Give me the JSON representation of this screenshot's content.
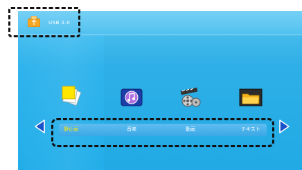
{
  "header": {
    "device_label": "USB 2.0",
    "device_icon": "usb-drive-icon"
  },
  "categories": [
    {
      "label": "静止画",
      "icon": "photo-icon",
      "selected": true
    },
    {
      "label": "音楽",
      "icon": "music-icon",
      "selected": false
    },
    {
      "label": "動画",
      "icon": "film-reel-icon",
      "selected": false
    },
    {
      "label": "テキスト",
      "icon": "folder-icon",
      "selected": false
    }
  ],
  "colors": {
    "background": "#22aee9",
    "selected_text": "#ffe600",
    "text": "#ffffff",
    "arrow": "#1a52c9"
  }
}
